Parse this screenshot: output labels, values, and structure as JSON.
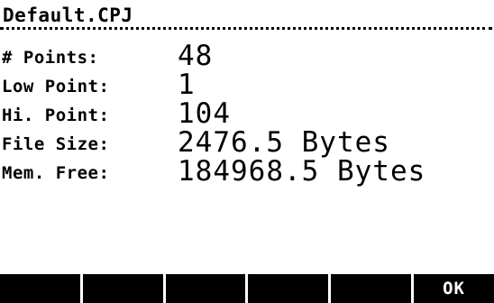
{
  "header": {
    "title": "Default.CPJ"
  },
  "info_rows": [
    {
      "label": "# Points:",
      "value": "48"
    },
    {
      "label": "Low Point:",
      "value": "1"
    },
    {
      "label": "Hi. Point:",
      "value": "104"
    },
    {
      "label": "File Size:",
      "value": "2476.5 Bytes"
    },
    {
      "label": "Mem. Free:",
      "value": "184968.5 Bytes"
    }
  ],
  "softkeys": [
    "",
    "",
    "",
    "",
    "",
    "OK"
  ]
}
